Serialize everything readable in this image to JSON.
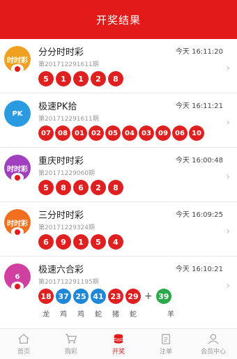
{
  "header": {
    "title": "开奖结果"
  },
  "lotteries": [
    {
      "name": "分分时时彩",
      "issue": "第201712291611期",
      "time": "今天 16:11:20",
      "logo_text": "时时彩",
      "logo_color": "#f0a020",
      "balls": [
        "5",
        "1",
        "1",
        "2",
        "8"
      ]
    },
    {
      "name": "极速PK拾",
      "issue": "第201712291611期",
      "time": "今天 16:11:21",
      "logo_text": "PK",
      "logo_color": "#2a9be0",
      "balls": [
        "07",
        "08",
        "01",
        "02",
        "05",
        "04",
        "03",
        "09",
        "06",
        "10"
      ]
    },
    {
      "name": "重庆时时彩",
      "issue": "第20171229060期",
      "time": "今天 16:00:48",
      "logo_text": "时时彩",
      "logo_color": "#a040c0",
      "balls": [
        "5",
        "8",
        "6",
        "2",
        "8"
      ]
    },
    {
      "name": "三分时时彩",
      "issue": "第20171229324期",
      "time": "今天 16:09:25",
      "logo_text": "时时彩",
      "logo_color": "#f07020",
      "balls": [
        "6",
        "9",
        "1",
        "5",
        "4"
      ]
    },
    {
      "name": "极速六合彩",
      "issue": "第201712291195期",
      "time": "今天 16:10:21",
      "logo_text": "6",
      "logo_color": "#d040a0",
      "balls": [
        {
          "n": "18",
          "c": "red"
        },
        {
          "n": "37",
          "c": "blue"
        },
        {
          "n": "25",
          "c": "blue"
        },
        {
          "n": "41",
          "c": "blue"
        },
        {
          "n": "23",
          "c": "red"
        },
        {
          "n": "29",
          "c": "red"
        }
      ],
      "special": {
        "n": "39",
        "c": "green"
      },
      "plus": "+",
      "zodiac": [
        "龙",
        "鸡",
        "鸡",
        "蛇",
        "猪",
        "蛇",
        "羊"
      ]
    }
  ],
  "tabs": [
    {
      "label": "首页",
      "icon": "home-icon"
    },
    {
      "label": "购彩",
      "icon": "cart-icon"
    },
    {
      "label": "开奖",
      "icon": "coins-icon",
      "active": true
    },
    {
      "label": "注单",
      "icon": "clipboard-icon"
    },
    {
      "label": "会员中心",
      "icon": "user-icon"
    }
  ],
  "colors": {
    "accent": "#e31a1a",
    "ball_red": "#e02020",
    "ball_blue": "#1e88d8",
    "ball_green": "#2aa84a"
  }
}
